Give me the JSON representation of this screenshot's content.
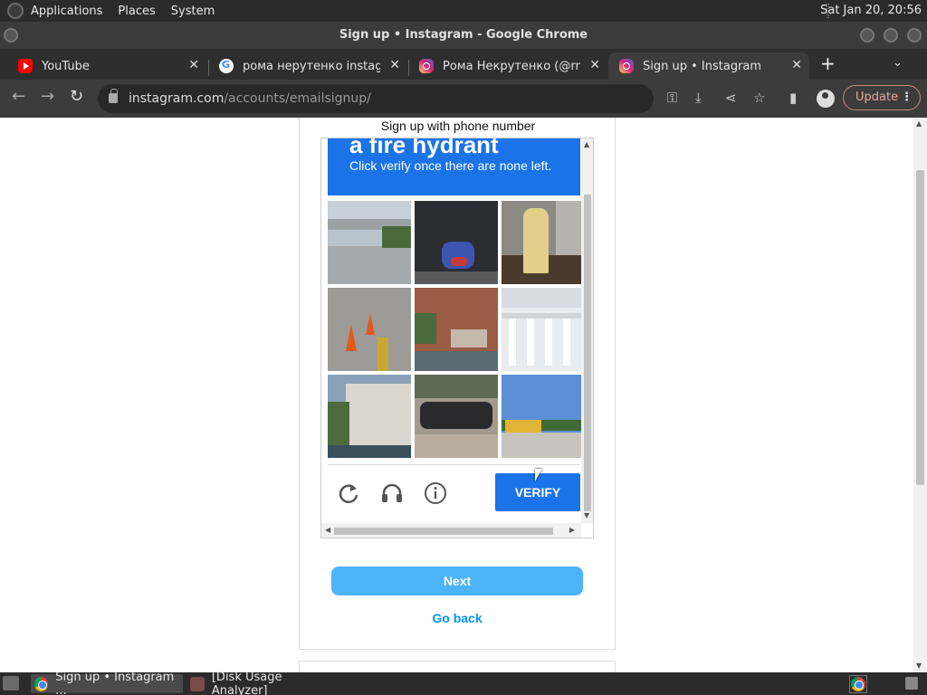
{
  "top_panel": {
    "menus": [
      "Applications",
      "Places",
      "System"
    ],
    "clock": "Sat Jan 20, 20:56"
  },
  "window": {
    "title": "Sign up • Instagram - Google Chrome"
  },
  "tabs": [
    {
      "label": "YouTube",
      "favicon": "youtube-icon"
    },
    {
      "label": "рома нерутенко instagram",
      "favicon": "google-icon"
    },
    {
      "label": "Рома Некрутенко (@rnek",
      "favicon": "instagram-icon"
    },
    {
      "label": "Sign up • Instagram",
      "favicon": "instagram-icon",
      "active": true
    }
  ],
  "toolbar": {
    "url_host": "instagram.com",
    "url_path": "/accounts/emailsignup/",
    "update_label": "Update"
  },
  "page": {
    "phone_label": "Sign up with phone number",
    "next_label": "Next",
    "go_back_label": "Go back"
  },
  "captcha": {
    "target": "a fire hydrant",
    "instruction": "Click verify once there are none left.",
    "verify_label": "VERIFY",
    "tiles": [
      "overpass road",
      "motorcycle rider",
      "fire hydrant",
      "traffic cones on sidewalk",
      "brick house with stairs",
      "white columns",
      "building facade",
      "motorcycles parked",
      "school buses"
    ],
    "icons": [
      "reload-icon",
      "audio-icon",
      "info-icon"
    ]
  },
  "taskbar": {
    "tasks": [
      {
        "label": "Sign up • Instagram ...",
        "active": true
      },
      {
        "label": "[Disk Usage Analyzer]",
        "active": false
      }
    ]
  },
  "colors": {
    "captcha_blue": "#1a73e8",
    "instagram_button": "#4cb5f9",
    "link_blue": "#0095f6"
  }
}
